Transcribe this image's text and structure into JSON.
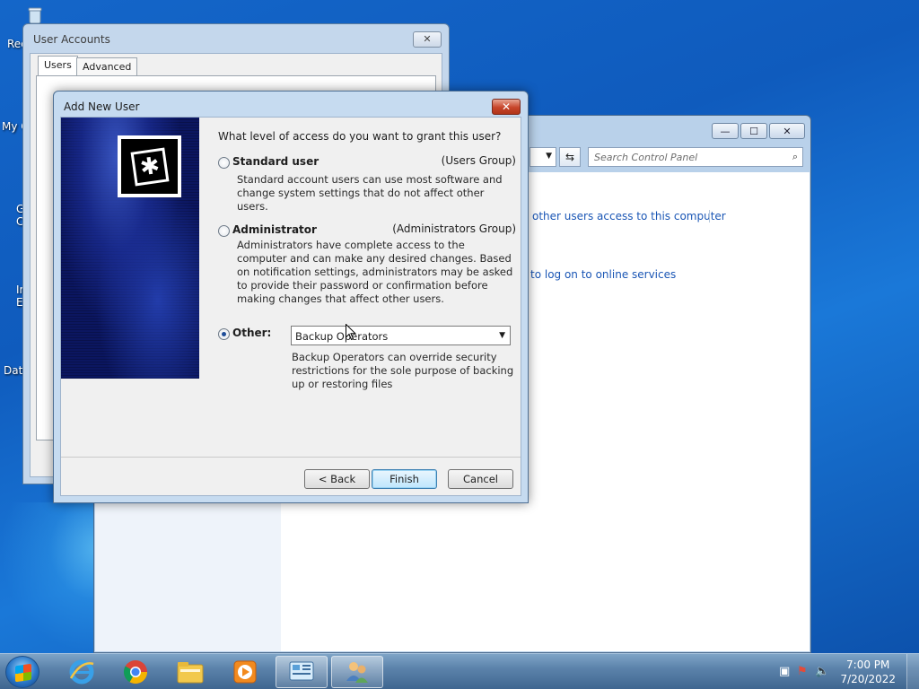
{
  "desktop": {
    "icons": [
      {
        "label": "Rec",
        "icon": "recycle-bin-icon"
      },
      {
        "label": "My C",
        "icon": "computer-icon"
      },
      {
        "label": "G\nC",
        "icon": "chrome-icon"
      },
      {
        "label": "In\nE",
        "icon": "ie-icon"
      },
      {
        "label": "Data",
        "icon": "data-icon"
      }
    ]
  },
  "control_panel": {
    "search_placeholder": "Search Control Panel",
    "links": [
      "other users access to this computer",
      "to log on to online services"
    ],
    "minimize": "—",
    "maximize": "☐",
    "close": "✕",
    "refresh": "⇆"
  },
  "user_accounts": {
    "title": "User Accounts",
    "close": "✕",
    "tabs": [
      "Users",
      "Advanced"
    ]
  },
  "dialog": {
    "title": "Add New User",
    "close": "✕",
    "question": "What level of access do you want to grant this user?",
    "options": [
      {
        "label": "Standard user",
        "group": "(Users Group)",
        "description": "Standard account users can use most software and change system settings that do not affect other users.",
        "checked": false
      },
      {
        "label": "Administrator",
        "group": "(Administrators Group)",
        "description": "Administrators have complete access to the computer and can make any desired changes. Based on notification settings, administrators may be asked to provide their password or confirmation before making changes that affect other users.",
        "checked": false
      },
      {
        "label": "Other:",
        "checked": true
      }
    ],
    "other_select_value": "Backup Operators",
    "other_description": "Backup Operators can override security restrictions for the sole purpose of backing up or restoring files",
    "buttons": {
      "back": "< Back",
      "finish": "Finish",
      "cancel": "Cancel"
    }
  },
  "taskbar": {
    "items": [
      "ie-icon",
      "chrome-icon",
      "explorer-icon",
      "media-player-icon",
      "control-panel-icon",
      "user-accounts-icon"
    ],
    "time": "7:00 PM",
    "date": "7/20/2022"
  },
  "colors": {
    "desktop": "#1466c9",
    "link": "#1a56b5",
    "close_red": "#c7452a"
  }
}
